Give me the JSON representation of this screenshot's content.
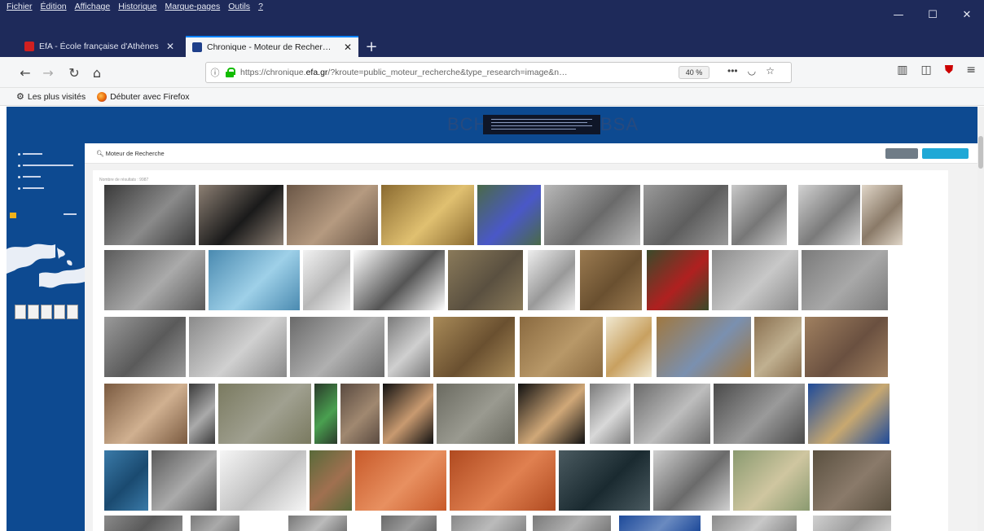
{
  "menu": [
    "Fichier",
    "Édition",
    "Affichage",
    "Historique",
    "Marque-pages",
    "Outils",
    "?"
  ],
  "window_controls": {
    "minimize": "—",
    "maximize": "☐",
    "close": "✕"
  },
  "tabs": [
    {
      "title": "EfA - École française d'Athènes",
      "active": false,
      "favicon_color": "#d02020"
    },
    {
      "title": "Chronique - Moteur de Recher…",
      "active": true,
      "favicon_color": "#1e3f8a"
    }
  ],
  "toolbar": {
    "url_prefix": "https://chronique.",
    "url_domain": "efa.gr",
    "url_suffix": "/?kroute=public_moteur_recherche&type_research=image&n…",
    "zoom": "40 %"
  },
  "bookmarks": [
    {
      "label": "Les plus visités",
      "icon": "gear-icon"
    },
    {
      "label": "Débuter avec Firefox",
      "icon": "firefox-icon"
    }
  ],
  "page": {
    "logo_left": "BCH",
    "logo_right": "BSA",
    "search_title": "Moteur de Recherche",
    "results_count": "Nombre de résultats : 9987"
  },
  "icons": {
    "back": "back-arrow-icon",
    "forward": "forward-arrow-icon",
    "reload": "reload-icon",
    "home": "home-icon",
    "more": "more-actions-icon",
    "pocket": "pocket-icon",
    "star": "bookmark-star-icon",
    "library": "library-icon",
    "sidebar": "sidebar-icon",
    "ublock": "ublock-icon",
    "menu": "hamburger-menu-icon"
  },
  "colors": {
    "frame": "#1e2a5a",
    "banner": "#0d4a91",
    "active_tab_accent": "#0a84ff",
    "btn_grey": "#6f7c87",
    "btn_blue": "#1fa8d6"
  }
}
